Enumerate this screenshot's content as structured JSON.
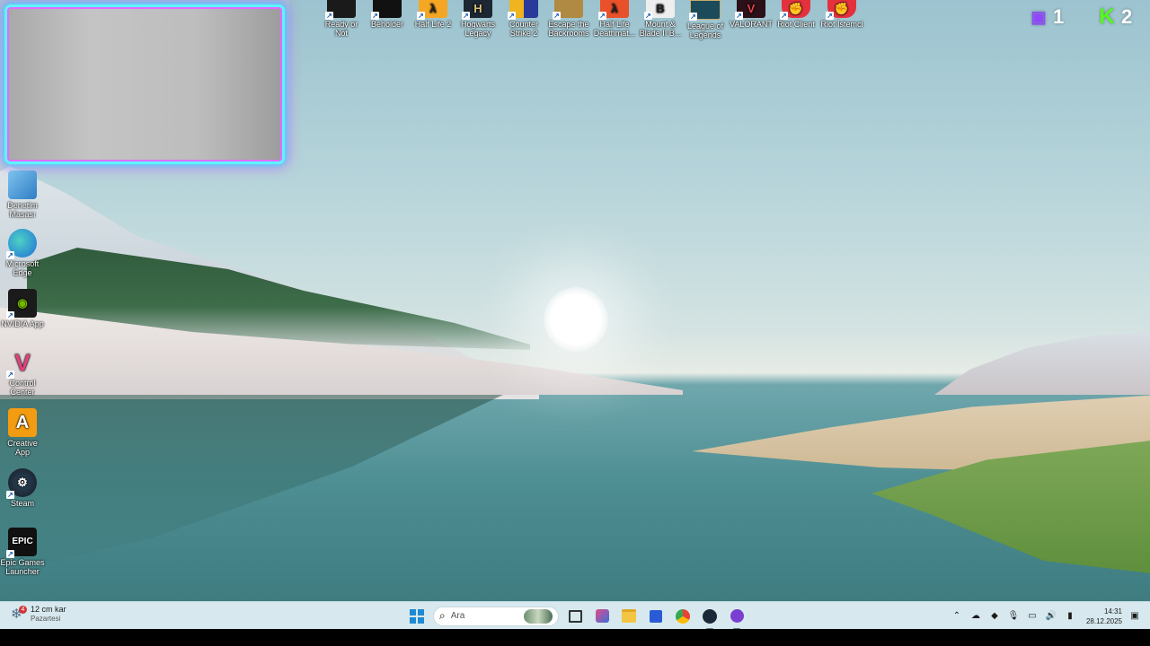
{
  "desktop": {
    "top_icons": [
      {
        "label": "Ready or Not",
        "icon": "ready-or-not-icon",
        "color": "#1a1a1a"
      },
      {
        "label": "Beholder",
        "icon": "beholder-icon",
        "color": "#111111"
      },
      {
        "label": "Half Life 2",
        "icon": "half-life-2-icon",
        "color": "#f5a623"
      },
      {
        "label": "Hogwarts Legacy",
        "icon": "hogwarts-legacy-icon",
        "color": "#1d2733"
      },
      {
        "label": "Counter Strike 2",
        "icon": "counter-strike-2-icon",
        "color": "#f0b41e"
      },
      {
        "label": "Escape the Backrooms",
        "icon": "escape-backrooms-icon",
        "color": "#b08a42"
      },
      {
        "label": "Half Life Deathmat...",
        "icon": "half-life-deathmatch-icon",
        "color": "#e8512a"
      },
      {
        "label": "Mount & Blade II B...",
        "icon": "mount-blade-icon",
        "color": "#eeeeee"
      },
      {
        "label": "League of Legends",
        "icon": "league-of-legends-icon",
        "color": "#1b4a5a"
      },
      {
        "label": "VALORANT",
        "icon": "valorant-icon",
        "color": "#e8404f"
      },
      {
        "label": "Riot Client",
        "icon": "riot-client-icon",
        "color": "#e3323d"
      },
      {
        "label": "Riot İstemci",
        "icon": "riot-client-tr-icon",
        "color": "#e3323d"
      }
    ],
    "left_icons": [
      {
        "label": "Denetim Masası",
        "icon": "control-panel-icon",
        "color": "#3c8fd8"
      },
      {
        "label": "Microsoft Edge",
        "icon": "edge-icon",
        "color": "#2a9d8f"
      },
      {
        "label": "NVIDIA App",
        "icon": "nvidia-icon",
        "color": "#1b1b1b"
      },
      {
        "label": "Control Center",
        "icon": "control-center-icon",
        "color": "#7b3fe4"
      },
      {
        "label": "Creative App",
        "icon": "creative-app-icon",
        "color": "#f39c12"
      },
      {
        "label": "Steam",
        "icon": "steam-icon",
        "color": "#1b2838"
      },
      {
        "label": "Epic Games Launcher",
        "icon": "epic-games-icon",
        "color": "#111111"
      }
    ],
    "badges": [
      {
        "platform": "twitch",
        "icon": "twitch-icon",
        "count": "1",
        "color": "#9146ff"
      },
      {
        "platform": "kick",
        "icon": "kick-icon",
        "count": "2",
        "color": "#53fc18"
      }
    ]
  },
  "taskbar": {
    "weather": {
      "icon": "snow-icon",
      "alert_count": "4",
      "line1": "12 cm kar",
      "line2": "Pazartesi"
    },
    "search_label": "Ara",
    "apps": [
      {
        "name": "task-view",
        "icon": "task-view-icon"
      },
      {
        "name": "app-1",
        "icon": "widget-app-icon"
      },
      {
        "name": "file-explorer",
        "icon": "folder-icon"
      },
      {
        "name": "store",
        "icon": "store-icon"
      },
      {
        "name": "chrome",
        "icon": "chrome-icon"
      },
      {
        "name": "steam",
        "icon": "steam-icon"
      },
      {
        "name": "app-purple",
        "icon": "purple-app-icon"
      }
    ],
    "tray": {
      "time": "14:31",
      "date": "28.12.2025"
    }
  }
}
